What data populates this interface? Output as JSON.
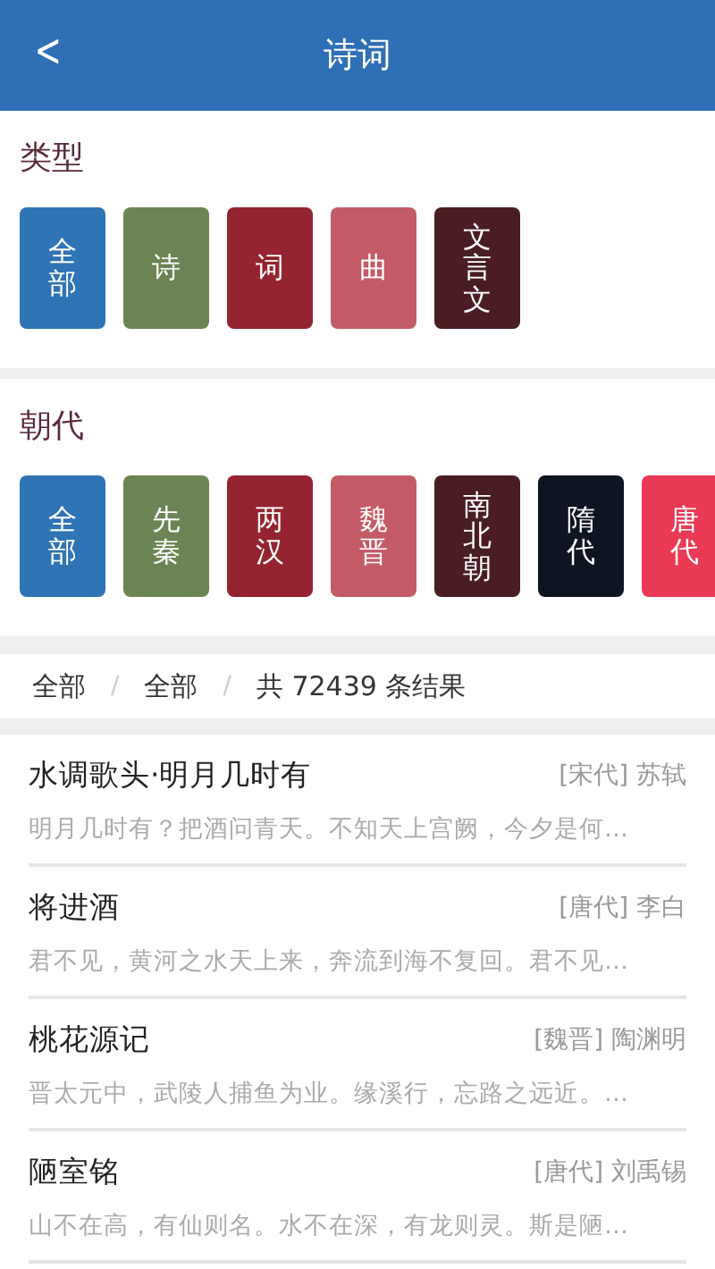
{
  "header": {
    "back": "<",
    "title": "诗词"
  },
  "sections": [
    {
      "title": "类型",
      "tiles": [
        {
          "label": "全部",
          "color": "#2f74b5"
        },
        {
          "label": "诗",
          "color": "#6a8553"
        },
        {
          "label": "词",
          "color": "#952430"
        },
        {
          "label": "曲",
          "color": "#c55a67"
        },
        {
          "label": "文言文",
          "color": "#4a1d23"
        }
      ]
    },
    {
      "title": "朝代",
      "tiles": [
        {
          "label": "全部",
          "color": "#2f74b5"
        },
        {
          "label": "先秦",
          "color": "#6a8553"
        },
        {
          "label": "两汉",
          "color": "#952430"
        },
        {
          "label": "魏晋",
          "color": "#c55a67"
        },
        {
          "label": "南北朝",
          "color": "#4a1d23"
        },
        {
          "label": "隋代",
          "color": "#0e1422"
        },
        {
          "label": "唐代",
          "color": "#ea3a55"
        }
      ]
    }
  ],
  "breadcrumb": {
    "items": [
      "全部",
      "全部"
    ],
    "separator": "/",
    "count": "共 72439 条结果"
  },
  "results": [
    {
      "title": "水调歌头·明月几时有",
      "meta": "[宋代] 苏轼",
      "snippet": "明月几时有？把酒问青天。不知天上宫阙，今夕是何…"
    },
    {
      "title": "将进酒",
      "meta": "[唐代] 李白",
      "snippet": "君不见，黄河之水天上来，奔流到海不复回。君不见…"
    },
    {
      "title": "桃花源记",
      "meta": "[魏晋] 陶渊明",
      "snippet": "晋太元中，武陵人捕鱼为业。缘溪行，忘路之远近。…"
    },
    {
      "title": "陋室铭",
      "meta": "[唐代] 刘禹锡",
      "snippet": "山不在高，有仙则名。水不在深，有龙则灵。斯是陋…"
    }
  ]
}
